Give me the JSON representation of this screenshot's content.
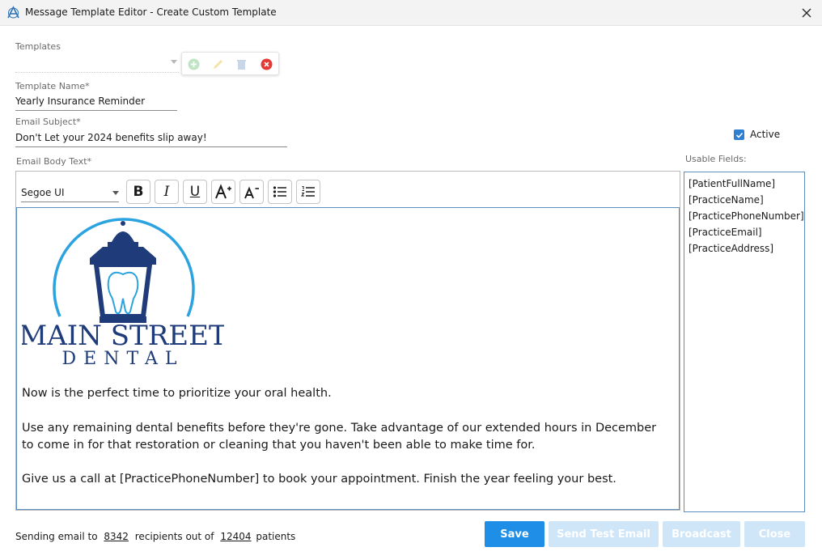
{
  "window": {
    "title": "Message Template Editor - Create Custom Template"
  },
  "templates": {
    "label": "Templates",
    "value": ""
  },
  "template_name": {
    "label": "Template Name*",
    "value": "Yearly Insurance Reminder"
  },
  "email_subject": {
    "label": "Email Subject*",
    "value": "Don't Let your 2024 benefits slip away!"
  },
  "active": {
    "label": "Active",
    "checked": true
  },
  "email_body": {
    "label": "Email Body Text*",
    "font": "Segoe UI",
    "logo": {
      "line1": "MAIN STREET",
      "line2": "DENTAL"
    },
    "paragraphs": [
      "Now is the perfect time to prioritize your oral health.",
      "Use any remaining dental benefits before they're gone. Take advantage of our extended hours in December to come in for that restoration or cleaning that you haven't been able to make time for.",
      "Give us a call at [PracticePhoneNumber] to book your appointment. Finish the year feeling your best."
    ]
  },
  "usable_fields": {
    "label": "Usable Fields:",
    "items": [
      "[PatientFullName]",
      "[PracticeName]",
      "[PracticePhoneNumber]",
      "[PracticeEmail]",
      "[PracticeAddress]"
    ]
  },
  "footer": {
    "prefix": "Sending email to",
    "recipients": "8342",
    "middle": "recipients out of",
    "total": "12404",
    "suffix": "patients"
  },
  "buttons": {
    "save": "Save",
    "send_test": "Send Test Email",
    "broadcast": "Broadcast",
    "close": "Close"
  },
  "colors": {
    "primary": "#1e8ee6",
    "disabled": "#cfe6f9",
    "logo_navy": "#1f3b7a",
    "logo_ring": "#2aa3e0"
  }
}
